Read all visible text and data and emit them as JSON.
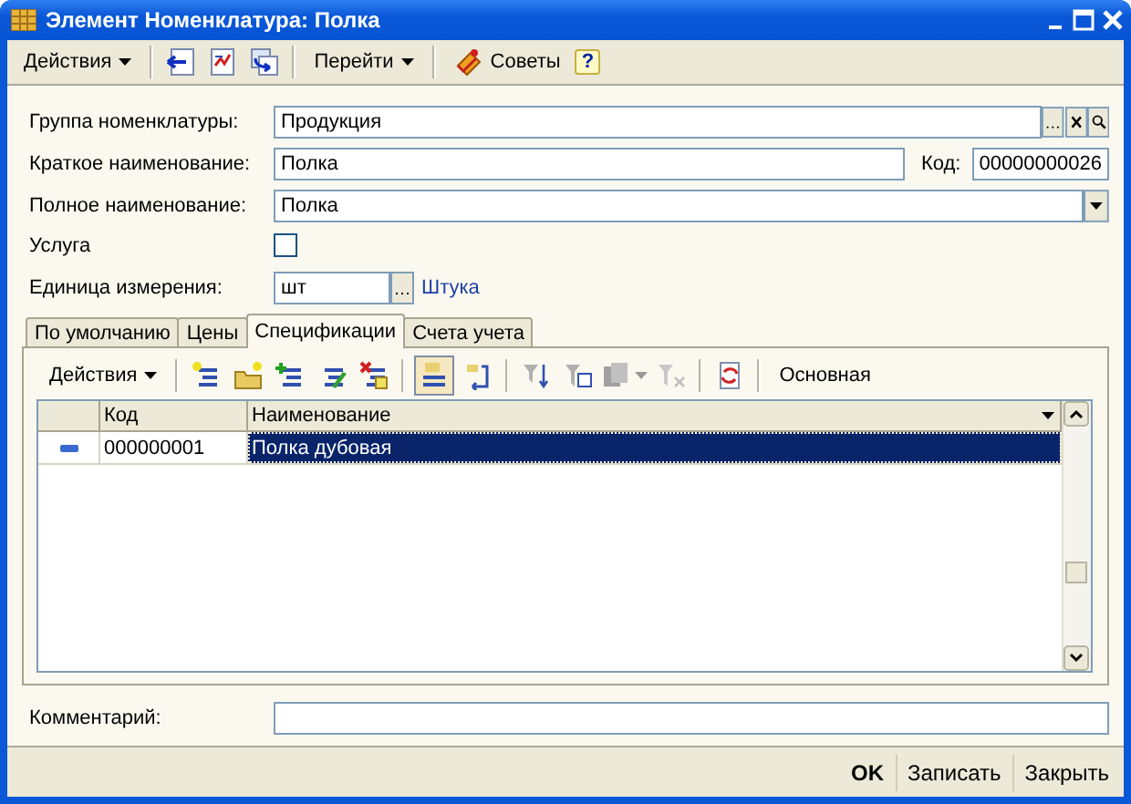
{
  "window": {
    "title": "Элемент Номенклатура: Полка"
  },
  "toolbar": {
    "actions_menu": "Действия",
    "goto_menu": "Перейти",
    "tips_button": "Советы",
    "help_button": "?"
  },
  "fields": [
    {
      "kind": "group",
      "label": "Группа номенклатуры:",
      "value": "Продукция"
    },
    {
      "kind": "coded",
      "label": "Краткое наименование:",
      "value": "Полка",
      "code_label": "Код:",
      "code_value": "00000000026"
    },
    {
      "kind": "dropdown",
      "label": "Полное наименование:",
      "value": "Полка"
    },
    {
      "kind": "checkbox",
      "label": "Услуга",
      "checked": false
    },
    {
      "kind": "unit",
      "label": "Единица измерения:",
      "value": "шт",
      "link": "Штука"
    }
  ],
  "tabs": [
    {
      "label": "По умолчанию",
      "selected": false
    },
    {
      "label": "Цены",
      "selected": false
    },
    {
      "label": "Спецификации",
      "selected": true
    },
    {
      "label": "Счета учета",
      "selected": false
    }
  ],
  "spec_toolbar": {
    "actions_menu": "Действия",
    "main_button": "Основная"
  },
  "table": {
    "columns": [
      "Код",
      "Наименование"
    ],
    "rows": [
      {
        "code": "000000001",
        "name": "Полка дубовая",
        "selected": true
      }
    ]
  },
  "comment": {
    "label": "Комментарий:"
  },
  "footer": {
    "buttons": [
      {
        "label": "OK",
        "default": true
      },
      {
        "label": "Записать",
        "default": false
      },
      {
        "label": "Закрыть",
        "default": false
      }
    ]
  }
}
